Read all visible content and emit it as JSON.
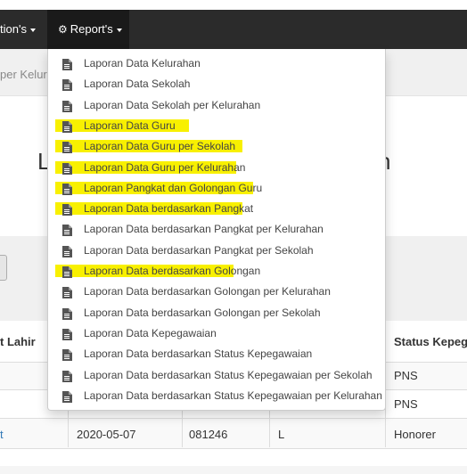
{
  "navbar": {
    "item1_label": "tion's",
    "item2_label": "Report's"
  },
  "breadcrumb": "per Kelur",
  "page_title": {
    "left_fragment": "L",
    "right_fragment": "n"
  },
  "table": {
    "headers": {
      "col1": "t Lahir",
      "col_status": "Status Kepegav"
    },
    "rows": [
      {
        "status": "PNS"
      },
      {
        "status": "PNS"
      },
      {
        "col0": "t",
        "date": "2020-05-07",
        "code": "081246",
        "gender": "L",
        "status": "Honorer"
      }
    ]
  },
  "report_menu": {
    "items": [
      {
        "label": "Laporan Data Kelurahan",
        "highlighted": false
      },
      {
        "label": "Laporan Data Sekolah",
        "highlighted": false
      },
      {
        "label": "Laporan Data Sekolah per Kelurahan",
        "highlighted": false
      },
      {
        "label": "Laporan Data Guru",
        "highlighted": true
      },
      {
        "label": "Laporan Data Guru per Sekolah",
        "highlighted": true
      },
      {
        "label": "Laporan Data Guru per Kelurahan",
        "highlighted": true
      },
      {
        "label": "Laporan Pangkat dan Golongan Guru",
        "highlighted": true
      },
      {
        "label": "Laporan Data berdasarkan Pangkat",
        "highlighted": true
      },
      {
        "label": "Laporan Data berdasarkan Pangkat per Kelurahan",
        "highlighted": false
      },
      {
        "label": "Laporan Data berdasarkan Pangkat per Sekolah",
        "highlighted": false
      },
      {
        "label": "Laporan Data berdasarkan Golongan",
        "highlighted": true
      },
      {
        "label": "Laporan Data berdasarkan Golongan per Kelurahan",
        "highlighted": false
      },
      {
        "label": "Laporan Data berdasarkan Golongan per Sekolah",
        "highlighted": false
      },
      {
        "label": "Laporan Data Kepegawaian",
        "highlighted": false
      },
      {
        "label": "Laporan Data berdasarkan Status Kepegawaian",
        "highlighted": false
      },
      {
        "label": "Laporan Data berdasarkan Status Kepegawaian per Sekolah",
        "highlighted": false
      },
      {
        "label": "Laporan Data berdasarkan Status Kepegawaian per Kelurahan",
        "highlighted": false
      }
    ]
  },
  "colors": {
    "navbar_bg": "#2b2b2b",
    "highlight": "#f8f000",
    "link": "#337ab7"
  },
  "icons": {
    "menu_item_icon": "document-icon",
    "report_icon": "gear-icon"
  }
}
